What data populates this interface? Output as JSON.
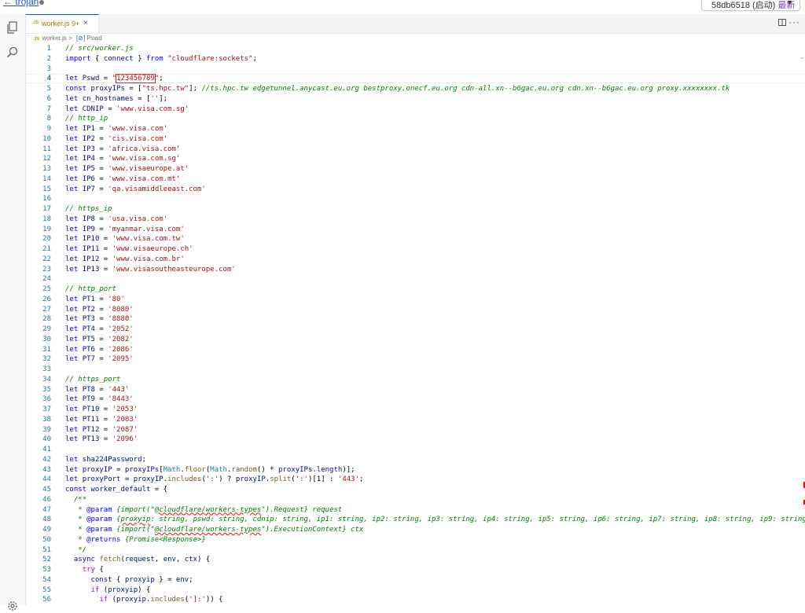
{
  "topbar": {
    "back_label": "← trojan",
    "commit_hash": "58db6518",
    "commit_status": "(启动)",
    "commit_tag": "最新"
  },
  "tab": {
    "icon_label": "JS",
    "filename": "worker.js",
    "problems": "9+",
    "close_glyph": "×"
  },
  "breadcrumb": {
    "file": "worker.js",
    "separator": ">",
    "symbol_glyph": "[⊘]",
    "symbol": "Pswd"
  },
  "code_lines": [
    {
      "n": "1",
      "t": "// src/worker.js"
    },
    {
      "n": "2",
      "t": "import { connect } from \"cloudflare:sockets\";"
    },
    {
      "n": "3",
      "t": ""
    },
    {
      "n": "4",
      "t": "let Pswd = \"123456789\";"
    },
    {
      "n": "5",
      "t": "const proxyIPs = [\"ts.hpc.tw\"]; //ts.hpc.tw edgetunnel.anycast.eu.org bestproxy.onecf.eu.org cdn-all.xn--b6gac.eu.org cdn.xn--b6gac.eu.org proxy.xxxxxxxx.tk"
    },
    {
      "n": "6",
      "t": "let cn_hostnames = [''];"
    },
    {
      "n": "7",
      "t": "let CDNIP = 'www.visa.com.sg'"
    },
    {
      "n": "8",
      "t": "// http_ip"
    },
    {
      "n": "9",
      "t": "let IP1 = 'www.visa.com'"
    },
    {
      "n": "10",
      "t": "let IP2 = 'cis.visa.com'"
    },
    {
      "n": "11",
      "t": "let IP3 = 'africa.visa.com'"
    },
    {
      "n": "12",
      "t": "let IP4 = 'www.visa.com.sg'"
    },
    {
      "n": "13",
      "t": "let IP5 = 'www.visaeurope.at'"
    },
    {
      "n": "14",
      "t": "let IP6 = 'www.visa.com.mt'"
    },
    {
      "n": "15",
      "t": "let IP7 = 'qa.visamiddleeast.com'"
    },
    {
      "n": "16",
      "t": ""
    },
    {
      "n": "17",
      "t": "// https_ip"
    },
    {
      "n": "18",
      "t": "let IP8 = 'usa.visa.com'"
    },
    {
      "n": "19",
      "t": "let IP9 = 'myanmar.visa.com'"
    },
    {
      "n": "20",
      "t": "let IP10 = 'www.visa.com.tw'"
    },
    {
      "n": "21",
      "t": "let IP11 = 'www.visaeurope.ch'"
    },
    {
      "n": "22",
      "t": "let IP12 = 'www.visa.com.br'"
    },
    {
      "n": "23",
      "t": "let IP13 = 'www.visasoutheasteurope.com'"
    },
    {
      "n": "24",
      "t": ""
    },
    {
      "n": "25",
      "t": "// http_port"
    },
    {
      "n": "26",
      "t": "let PT1 = '80'"
    },
    {
      "n": "27",
      "t": "let PT2 = '8080'"
    },
    {
      "n": "28",
      "t": "let PT3 = '8880'"
    },
    {
      "n": "29",
      "t": "let PT4 = '2052'"
    },
    {
      "n": "30",
      "t": "let PT5 = '2082'"
    },
    {
      "n": "31",
      "t": "let PT6 = '2086'"
    },
    {
      "n": "32",
      "t": "let PT7 = '2095'"
    },
    {
      "n": "33",
      "t": ""
    },
    {
      "n": "34",
      "t": "// https_port"
    },
    {
      "n": "35",
      "t": "let PT8 = '443'"
    },
    {
      "n": "36",
      "t": "let PT9 = '8443'"
    },
    {
      "n": "37",
      "t": "let PT10 = '2053'"
    },
    {
      "n": "38",
      "t": "let PT11 = '2083'"
    },
    {
      "n": "39",
      "t": "let PT12 = '2087'"
    },
    {
      "n": "40",
      "t": "let PT13 = '2096'"
    },
    {
      "n": "41",
      "t": ""
    },
    {
      "n": "42",
      "t": "let sha224Password;"
    },
    {
      "n": "43",
      "t": "let proxyIP = proxyIPs[Math.floor(Math.random() * proxyIPs.length)];"
    },
    {
      "n": "44",
      "t": "let proxyPort = proxyIP.includes(':') ? proxyIP.split(':')[1] : '443';"
    },
    {
      "n": "45",
      "t": "const worker_default = {"
    },
    {
      "n": "46",
      "t": "  /**"
    },
    {
      "n": "47",
      "t": "   * @param {import(\"@cloudflare/workers-types\").Request} request"
    },
    {
      "n": "48",
      "t": "   * @param {proxyip: string, pswd: string, cdnip: string, ip1: string, ip2: string, ip3: string, ip4: string, ip5: string, ip6: string, ip7: string, ip8: string, ip9: string, ip10"
    },
    {
      "n": "49",
      "t": "   * @param {import(\"@cloudflare/workers-types\").ExecutionContext} ctx"
    },
    {
      "n": "50",
      "t": "   * @returns {Promise<Response>}"
    },
    {
      "n": "51",
      "t": "   */"
    },
    {
      "n": "52",
      "t": "  async fetch(request, env, ctx) {"
    },
    {
      "n": "53",
      "t": "    try {"
    },
    {
      "n": "54",
      "t": "      const { proxyip } = env;"
    },
    {
      "n": "55",
      "t": "      if (proxyip) {"
    },
    {
      "n": "56",
      "t": "        if (proxyip.includes(']:')) {"
    }
  ]
}
